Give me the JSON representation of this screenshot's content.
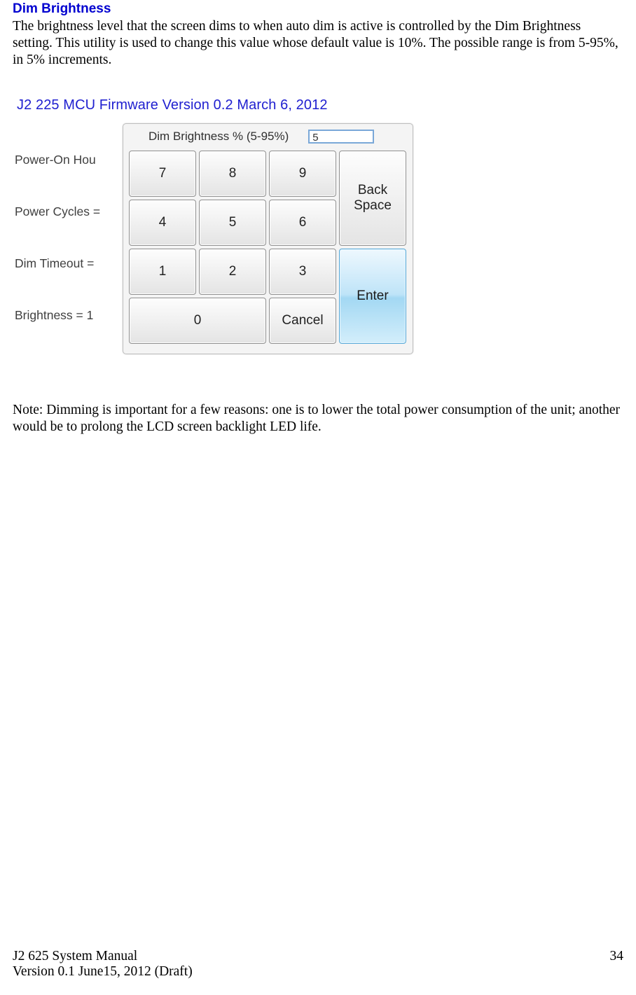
{
  "heading": "Dim Brightness",
  "paragraph": "The brightness level that the screen dims to when auto dim is active is controlled by the Dim Brightness setting. This utility is used to change this value whose default value is 10%. The possible range is from 5-95%, in 5% increments.",
  "screenshot": {
    "title": "J2 225 MCU Firmware Version 0.2 March 6, 2012",
    "bg_labels": {
      "l1": "Power-On Hou",
      "l2": "Power Cycles =",
      "l3": "Dim Timeout =",
      "l4": "Brightness = 1"
    },
    "dialog": {
      "label": "Dim Brightness % (5-95%)",
      "value": "5",
      "keys": {
        "k7": "7",
        "k8": "8",
        "k9": "9",
        "k4": "4",
        "k5": "5",
        "k6": "6",
        "k1": "1",
        "k2": "2",
        "k3": "3",
        "k0": "0",
        "backspace": "Back\nSpace",
        "cancel": "Cancel",
        "enter": "Enter"
      }
    }
  },
  "note": "Note: Dimming is important for a few reasons: one is to lower the total power consumption of the unit; another would be to prolong the LCD screen backlight LED life.",
  "footer": {
    "doc_title": "J2 625 System Manual",
    "doc_version": "Version 0.1 June15, 2012 (Draft)",
    "page_number": "34"
  }
}
